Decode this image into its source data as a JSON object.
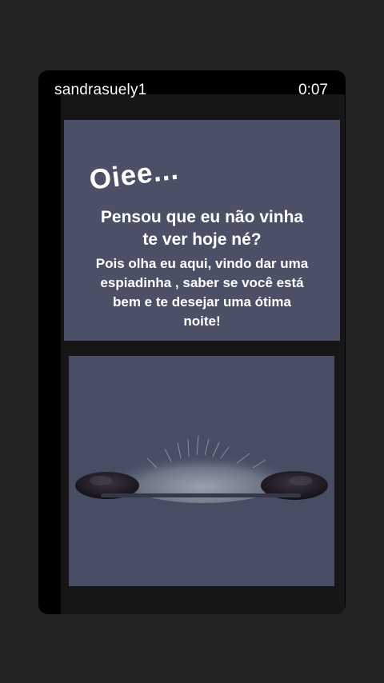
{
  "story": {
    "username": "sandrasuely1",
    "timer": "0:07"
  },
  "post": {
    "greeting": "Oiee...",
    "headline_lines": [
      "Pensou que eu não vinha",
      "te ver hoje né?"
    ],
    "body_lines": [
      "Pois olha eu aqui, vindo dar uma",
      "espiadinha , saber se você está",
      "bem e te desejar uma ótima",
      "noite!"
    ]
  },
  "image": {
    "subject": "cat-peeking-illustration",
    "background_color": "#474d63",
    "fur_color": "#8b8f9c",
    "paw_color": "#1e1b24"
  },
  "colors": {
    "page_background": "#232323",
    "card_background": "#000000",
    "text_panel": "#4b5066",
    "text": "#ffffff"
  }
}
